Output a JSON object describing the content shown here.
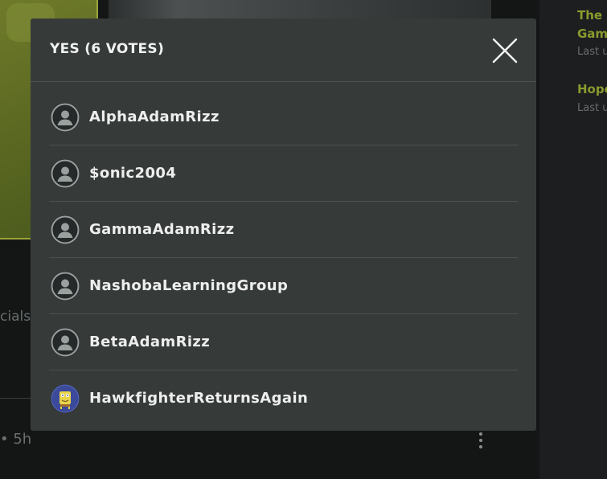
{
  "background": {
    "sidebar_links": [
      {
        "title": "The I",
        "subtitle": "Gam",
        "meta": "Last u"
      },
      {
        "title": "Hope",
        "meta": "Last u"
      }
    ],
    "partial_text": "cials",
    "post_time": "• 5h",
    "more_icon": "more-vertical-icon"
  },
  "modal": {
    "title": "YES (6 VOTES)",
    "close_icon": "close-icon",
    "voters": [
      {
        "name": "AlphaAdamRizz",
        "avatar": "default-user-icon"
      },
      {
        "name": "$onic2004",
        "avatar": "default-user-icon"
      },
      {
        "name": "GammaAdamRizz",
        "avatar": "default-user-icon"
      },
      {
        "name": "NashobaLearningGroup",
        "avatar": "default-user-icon"
      },
      {
        "name": "BetaAdamRizz",
        "avatar": "default-user-icon"
      },
      {
        "name": "HawkfighterReturnsAgain",
        "avatar": "spongebob-avatar"
      }
    ]
  },
  "colors": {
    "modal_bg": "#363b3a",
    "divider": "#4b5150",
    "text": "#eeeeee",
    "accent_link": "#8a9a2e"
  }
}
